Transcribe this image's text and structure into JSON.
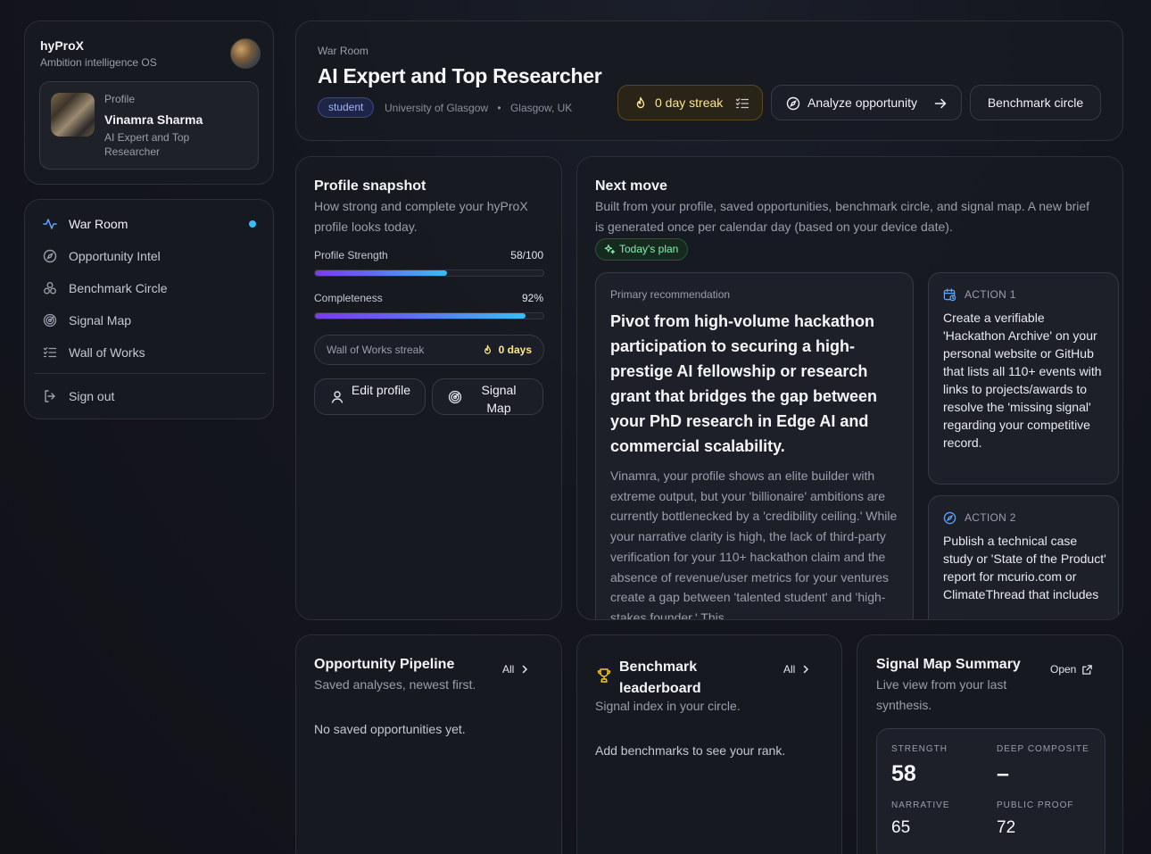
{
  "brand": {
    "name": "hyProX",
    "tagline": "Ambition intelligence OS"
  },
  "profile_card": {
    "kicker": "Profile",
    "name": "Vinamra Sharma",
    "role": "AI Expert and Top Researcher"
  },
  "nav": {
    "items": [
      {
        "label": "War Room",
        "icon": "activity-icon",
        "active": true
      },
      {
        "label": "Opportunity Intel",
        "icon": "compass-icon"
      },
      {
        "label": "Benchmark Circle",
        "icon": "users-icon"
      },
      {
        "label": "Signal Map",
        "icon": "radar-icon"
      },
      {
        "label": "Wall of Works",
        "icon": "list-checks-icon"
      }
    ],
    "sign_out": "Sign out"
  },
  "header": {
    "kicker": "War Room",
    "title": "AI Expert and Top Researcher",
    "badge": "student",
    "university": "University of Glasgow",
    "location": "Glasgow, UK",
    "streak_button": "0 day streak",
    "analyze_button": "Analyze opportunity",
    "benchmark_button": "Benchmark circle"
  },
  "snapshot": {
    "title": "Profile snapshot",
    "subtitle": "How strong and complete your hyProX profile looks today.",
    "strength_label": "Profile Strength",
    "strength_value": "58/100",
    "strength_fraction": 0.58,
    "completeness_label": "Completeness",
    "completeness_value": "92%",
    "completeness_fraction": 0.92,
    "streak_label": "Wall of Works streak",
    "streak_value": "0 days",
    "edit_button": "Edit profile",
    "signal_button": "Signal Map"
  },
  "next_move": {
    "title": "Next move",
    "subtitle": "Built from your profile, saved opportunities, benchmark circle, and signal map. A new brief is generated once per calendar day (based on your device date).",
    "plan_pill": "Today's plan",
    "primary_kicker": "Primary recommendation",
    "primary_headline": "Pivot from high-volume hackathon participation to securing a high-prestige AI fellowship or research grant that bridges the gap between your PhD research in Edge AI and commercial scalability.",
    "primary_body": "Vinamra, your profile shows an elite builder with extreme output, but your 'billionaire' ambitions are currently bottlenecked by a 'credibility ceiling.' While your narrative clarity is high, the lack of third-party verification for your 110+ hackathon claim and the absence of revenue/user metrics for your ventures create a gap between 'talented student' and 'high-stakes founder.' This",
    "actions": [
      {
        "kicker": "ACTION 1",
        "text": "Create a verifiable 'Hackathon Archive' on your personal website or GitHub that lists all 110+ events with links to projects/awards to resolve the 'missing signal' regarding your competitive record."
      },
      {
        "kicker": "ACTION 2",
        "text": "Publish a technical case study or 'State of the Product' report for mcurio.com or ClimateThread that includes"
      }
    ]
  },
  "pipeline": {
    "title": "Opportunity Pipeline",
    "subtitle": "Saved analyses, newest first.",
    "all_link": "All",
    "empty": "No saved opportunities yet."
  },
  "leaderboard": {
    "title": "Benchmark leaderboard",
    "subtitle": "Signal index in your circle.",
    "all_link": "All",
    "empty": "Add benchmarks to see your rank."
  },
  "signal_summary": {
    "title": "Signal Map Summary",
    "subtitle": "Live view from your last synthesis.",
    "open_link": "Open",
    "strength_label": "STRENGTH",
    "strength_value": "58",
    "deep_label": "DEEP COMPOSITE",
    "deep_value": "–",
    "narrative_label": "NARRATIVE",
    "narrative_value": "65",
    "proof_label": "PUBLIC PROOF",
    "proof_value": "72"
  },
  "colors": {
    "accent_blue": "#38bdf8",
    "accent_violet": "#7c3aed",
    "streak_amber": "#fde68a",
    "plan_green": "#86efac"
  }
}
